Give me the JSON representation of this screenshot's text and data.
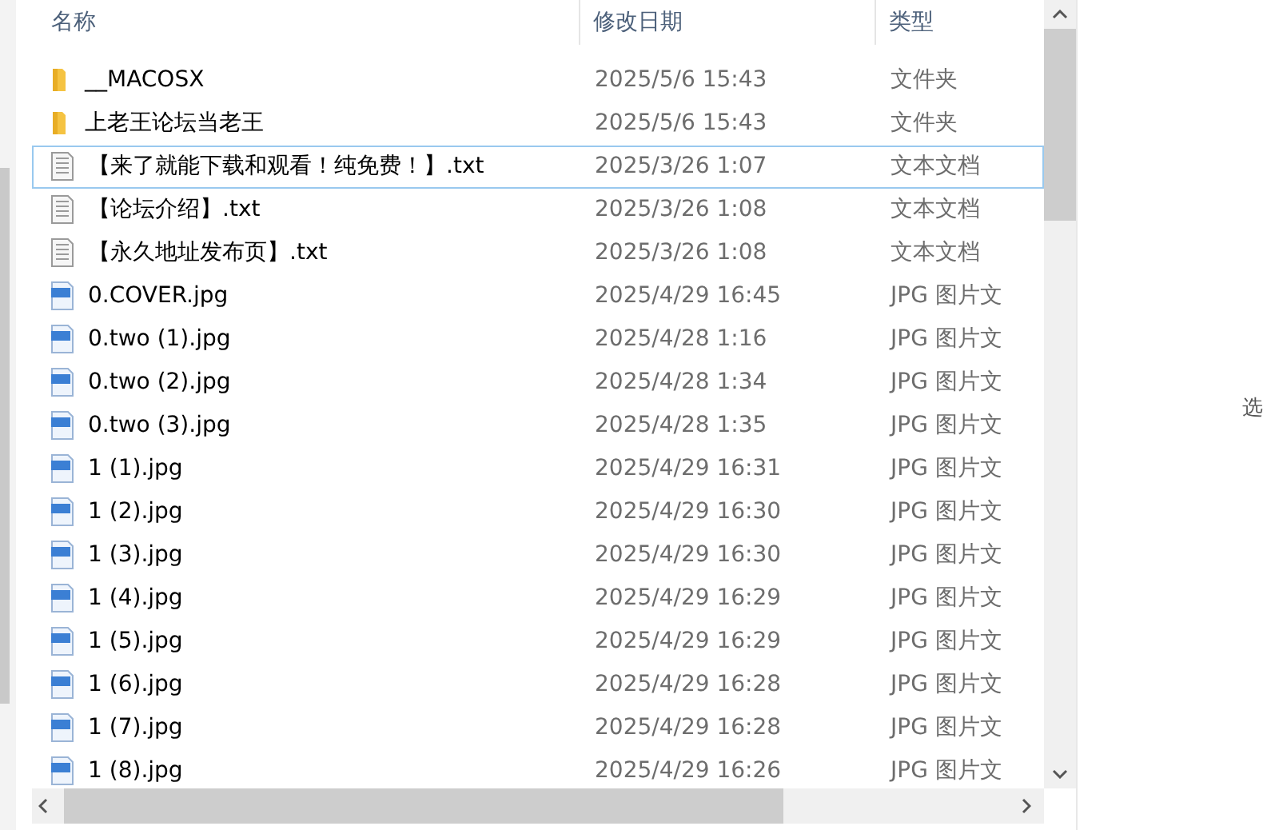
{
  "columns": [
    {
      "label": "名称"
    },
    {
      "label": "修改日期"
    },
    {
      "label": "类型"
    }
  ],
  "rows": [
    {
      "kind": "folder",
      "name": "__MACOSX",
      "date": "2025/5/6 15:43",
      "type": "文件夹",
      "focused": false
    },
    {
      "kind": "folder",
      "name": "上老王论坛当老王",
      "date": "2025/5/6 15:43",
      "type": "文件夹",
      "focused": false
    },
    {
      "kind": "text",
      "name": "【来了就能下载和观看！纯免费！】.txt",
      "date": "2025/3/26 1:07",
      "type": "文本文档",
      "focused": true
    },
    {
      "kind": "text",
      "name": "【论坛介绍】.txt",
      "date": "2025/3/26 1:08",
      "type": "文本文档",
      "focused": false
    },
    {
      "kind": "text",
      "name": "【永久地址发布页】.txt",
      "date": "2025/3/26 1:08",
      "type": "文本文档",
      "focused": false
    },
    {
      "kind": "image",
      "name": "0.COVER.jpg",
      "date": "2025/4/29 16:45",
      "type": "JPG 图片文",
      "focused": false
    },
    {
      "kind": "image",
      "name": "0.two (1).jpg",
      "date": "2025/4/28 1:16",
      "type": "JPG 图片文",
      "focused": false
    },
    {
      "kind": "image",
      "name": "0.two (2).jpg",
      "date": "2025/4/28 1:34",
      "type": "JPG 图片文",
      "focused": false
    },
    {
      "kind": "image",
      "name": "0.two (3).jpg",
      "date": "2025/4/28 1:35",
      "type": "JPG 图片文",
      "focused": false
    },
    {
      "kind": "image",
      "name": "1 (1).jpg",
      "date": "2025/4/29 16:31",
      "type": "JPG 图片文",
      "focused": false
    },
    {
      "kind": "image",
      "name": "1 (2).jpg",
      "date": "2025/4/29 16:30",
      "type": "JPG 图片文",
      "focused": false
    },
    {
      "kind": "image",
      "name": "1 (3).jpg",
      "date": "2025/4/29 16:30",
      "type": "JPG 图片文",
      "focused": false
    },
    {
      "kind": "image",
      "name": "1 (4).jpg",
      "date": "2025/4/29 16:29",
      "type": "JPG 图片文",
      "focused": false
    },
    {
      "kind": "image",
      "name": "1 (5).jpg",
      "date": "2025/4/29 16:29",
      "type": "JPG 图片文",
      "focused": false
    },
    {
      "kind": "image",
      "name": "1 (6).jpg",
      "date": "2025/4/29 16:28",
      "type": "JPG 图片文",
      "focused": false
    },
    {
      "kind": "image",
      "name": "1 (7).jpg",
      "date": "2025/4/29 16:28",
      "type": "JPG 图片文",
      "focused": false
    },
    {
      "kind": "image",
      "name": "1 (8).jpg",
      "date": "2025/4/29 16:26",
      "type": "JPG 图片文",
      "focused": false
    }
  ],
  "preview_pane": {
    "message": "选"
  }
}
